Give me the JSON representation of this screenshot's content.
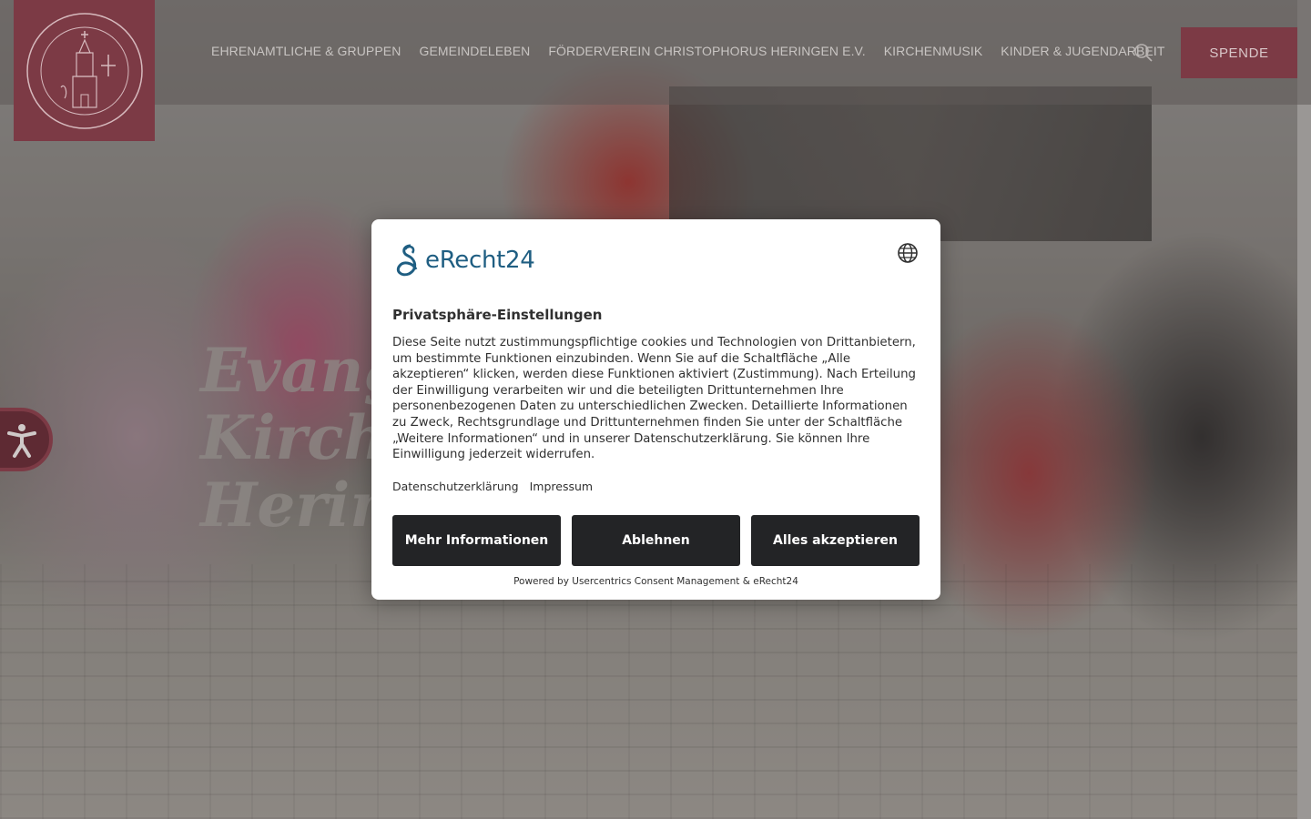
{
  "header": {
    "logo_alt": "Heringen Evangelische Kirchengemeinde",
    "nav": [
      {
        "label": "EHRENAMTLICHE & GRUPPEN"
      },
      {
        "label": "GEMEINDELEBEN"
      },
      {
        "label": "FÖRDERVEREIN CHRISTOPHORUS HERINGEN E.V."
      },
      {
        "label": "KIRCHENMUSIK"
      },
      {
        "label": "KINDER & JUGENDARBEIT"
      }
    ],
    "search_icon": "search-icon",
    "cta_label": "SPENDE"
  },
  "hero": {
    "title_line1": "Evangelische Kirchengemeinde",
    "title_line2": "Heringen"
  },
  "accessibility": {
    "icon": "accessibility-icon"
  },
  "consent": {
    "brand": "eRecht24",
    "globe_icon": "globe-icon",
    "heading": "Privatsphäre-Einstellungen",
    "body": "Diese Seite nutzt zustimmungspflichtige cookies und Technologien von Drittanbietern, um bestimmte Funktionen einzubinden. Wenn Sie auf die Schaltfläche „Alle akzeptieren“ klicken, werden diese Funktionen aktiviert (Zustimmung). Nach Erteilung der Einwilligung verarbeiten wir und die beteiligten Drittunternehmen Ihre personenbezogenen Daten zu unterschiedlichen Zwecken. Detaillierte Informationen zu Zweck, Rechtsgrundlage und Drittunternehmen finden Sie unter der Schaltfläche „Weitere Informationen“ und in unserer Datenschutzerklärung. Sie können Ihre Einwilligung jederzeit widerrufen.",
    "links": [
      {
        "label": "Datenschutzerklärung"
      },
      {
        "label": "Impressum"
      }
    ],
    "buttons": {
      "more": "Mehr Informationen",
      "deny": "Ablehnen",
      "accept": "Alles akzeptieren"
    },
    "powered_by": "Powered by Usercentrics Consent Management & eRecht24"
  },
  "colors": {
    "brand_red": "#7c3a45",
    "button_dark": "#232426",
    "erecht_blue": "#1f5e82"
  }
}
